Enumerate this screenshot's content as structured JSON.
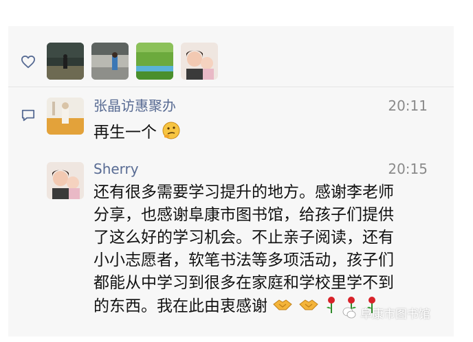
{
  "likes": {
    "heart_icon": "heart-outline-icon",
    "avatars": [
      "avatar-1",
      "avatar-2",
      "avatar-3",
      "avatar-4"
    ]
  },
  "comments": [
    {
      "name": "张晶访惠聚办",
      "time": "20:11",
      "text": "再生一个",
      "emoji": "thinking-face-icon"
    },
    {
      "name": "Sherry",
      "time": "20:15",
      "lines": [
        "还有很多需要学习提升的地方。感谢李老师",
        "分享，也感谢阜康市图书馆，给孩子们提供",
        "了这么好的学习机会。不止亲子阅读，还有",
        "小小志愿者，软笔书法等多项活动，孩子们",
        "都能从中学习到很多在家庭和学校里学不到",
        "的东西。我在此由衷感谢"
      ]
    }
  ],
  "watermark": "阜康市图书馆",
  "colors": {
    "name": "#586b93",
    "panel": "#f7f7f7"
  }
}
